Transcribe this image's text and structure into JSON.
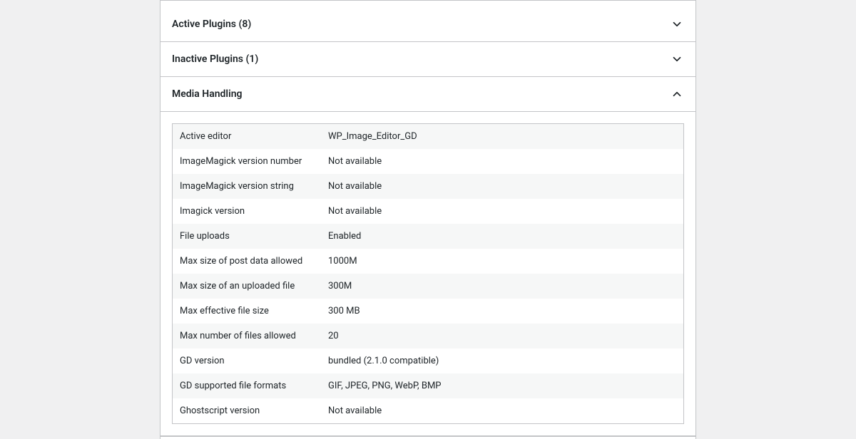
{
  "sections": {
    "active_plugins": {
      "title": "Active Plugins (8)"
    },
    "inactive_plugins": {
      "title": "Inactive Plugins (1)"
    },
    "media_handling": {
      "title": "Media Handling",
      "rows": [
        {
          "label": "Active editor",
          "value": "WP_Image_Editor_GD"
        },
        {
          "label": "ImageMagick version number",
          "value": "Not available"
        },
        {
          "label": "ImageMagick version string",
          "value": "Not available"
        },
        {
          "label": "Imagick version",
          "value": "Not available"
        },
        {
          "label": "File uploads",
          "value": "Enabled"
        },
        {
          "label": "Max size of post data allowed",
          "value": "1000M"
        },
        {
          "label": "Max size of an uploaded file",
          "value": "300M"
        },
        {
          "label": "Max effective file size",
          "value": "300 MB"
        },
        {
          "label": "Max number of files allowed",
          "value": "20"
        },
        {
          "label": "GD version",
          "value": "bundled (2.1.0 compatible)"
        },
        {
          "label": "GD supported file formats",
          "value": "GIF, JPEG, PNG, WebP, BMP"
        },
        {
          "label": "Ghostscript version",
          "value": "Not available"
        }
      ]
    }
  }
}
